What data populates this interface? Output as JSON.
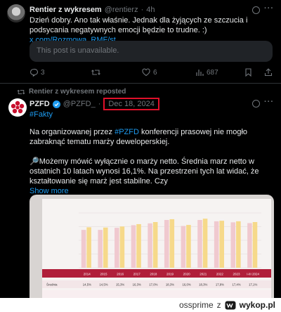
{
  "post1": {
    "author_name": "Rentier z wykresem",
    "handle": "@rentierz",
    "dot": "·",
    "time": "4h",
    "text": "Dzień dobry. Ano tak właśnie. Jednak dla żyjących ze szczucia i podsycania negatywnych emocji będzie to trudne. :) ",
    "link": "x.com/Rozmowa_RMF/st...",
    "quote_unavailable": "This post is unavailable.",
    "replies": "3",
    "likes": "6",
    "views": "687"
  },
  "post2": {
    "repost_label": "Rentier z wykresem reposted",
    "author_name": "PZFD",
    "handle": "@PZFD_",
    "dot": "·",
    "date": "Dec 18, 2024",
    "hashtag": "#Fakty",
    "para1_a": "Na organizowanej przez ",
    "para1_tag": "#PZFD",
    "para1_b": " konferencji prasowej nie mogło zabraknąć tematu marży deweloperskiej.",
    "para2": "🔎Możemy mówić wyłącznie o marży netto. Średnia marz netto w ostatnich 10 latach wynosi 16,1%. Na przestrzeni tych lat widać, że kształtowanie się marż jest stabilne. Czy",
    "show_more": "Show more"
  },
  "chart_data": {
    "type": "bar",
    "categories": [
      "2014",
      "2015",
      "2016",
      "2017",
      "2018",
      "2019",
      "2020",
      "2021",
      "2022",
      "2023",
      "I-III 2024"
    ],
    "series": [
      {
        "values": [
          14.5,
          14.5,
          15.3,
          16.3,
          17.0,
          18.3,
          16.0,
          18.3,
          17.8,
          17.4,
          17.1
        ],
        "color": "#f0c9cf"
      },
      {
        "values": [
          15.5,
          15.4,
          15.8,
          16.7,
          17.5,
          18.6,
          16.4,
          18.8,
          18.0,
          17.8,
          17.5
        ],
        "color": "#f6d98a"
      }
    ],
    "ylim": [
      0,
      21
    ],
    "row_label": "Średnia",
    "row_values": [
      "14,5%",
      "14,5%",
      "15,3%",
      "16,3%",
      "17,0%",
      "18,3%",
      "16,0%",
      "18,3%",
      "17,8%",
      "17,4%",
      "17,1%"
    ]
  },
  "footer": {
    "username": "ossprime",
    "z": "z",
    "brand": "wykop.pl"
  }
}
